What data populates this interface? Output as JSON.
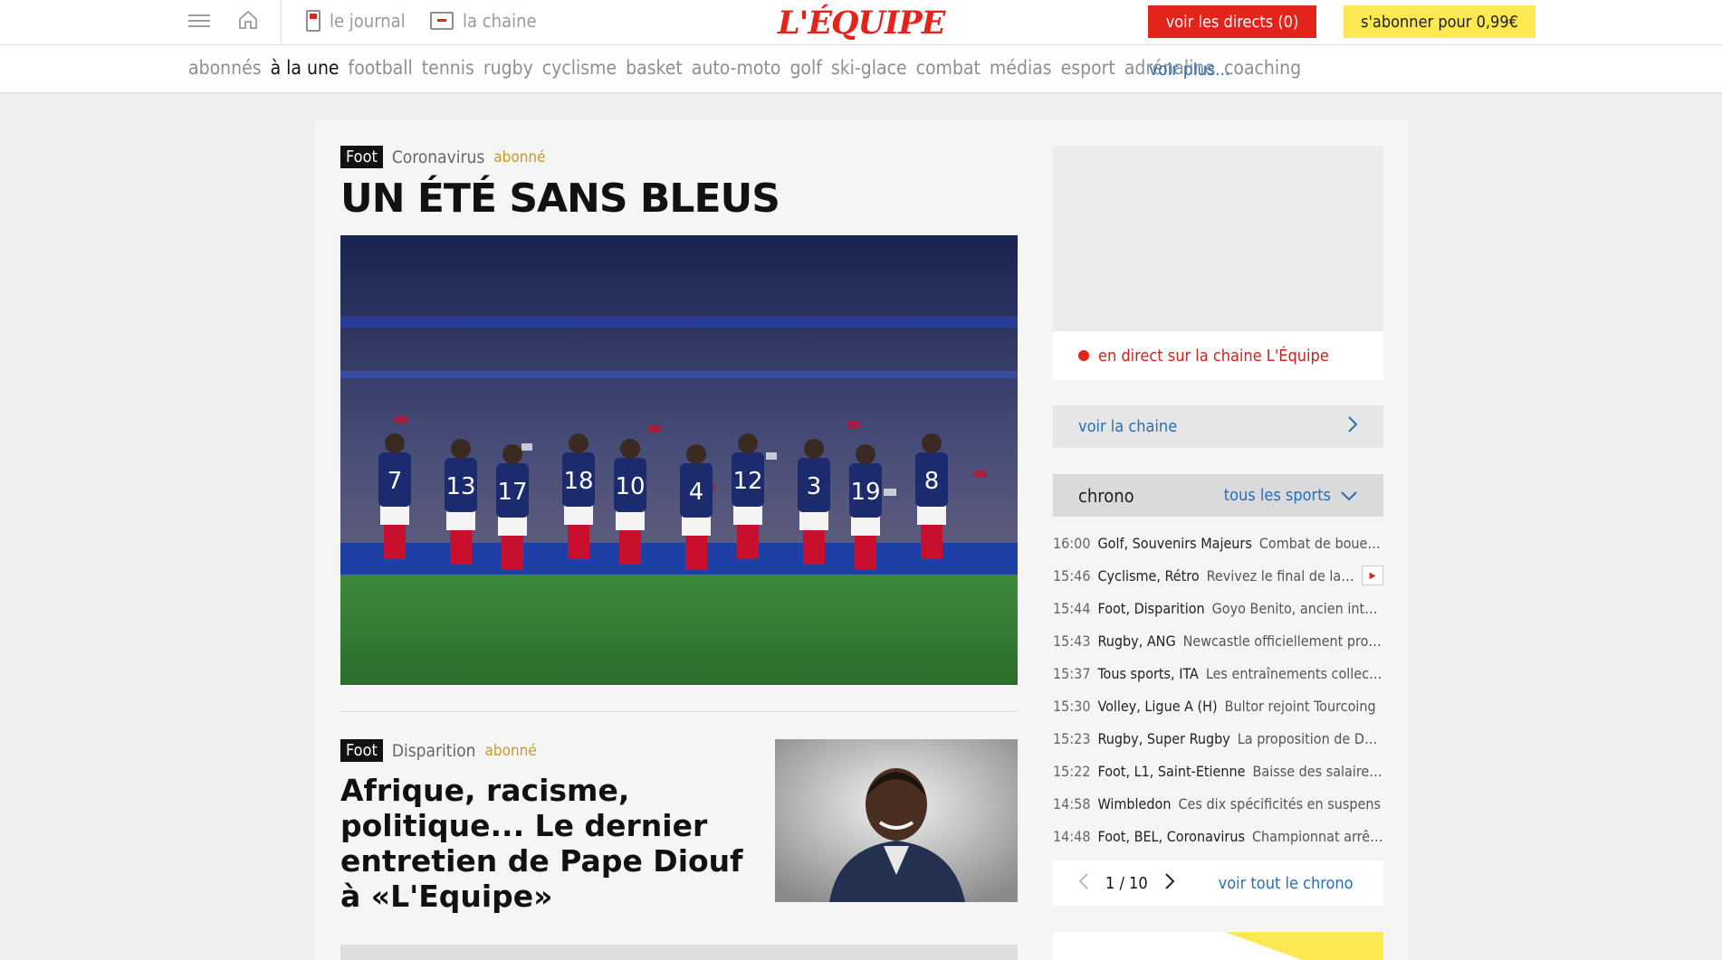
{
  "header": {
    "journal_label": "le journal",
    "chaine_label": "la chaine",
    "logo": "L'ÉQUIPE",
    "directs_label": "voir les directs (0)",
    "abonner_label": "s'abonner pour 0,99€"
  },
  "nav": {
    "items": [
      "abonnés",
      "à la une",
      "football",
      "tennis",
      "rugby",
      "cyclisme",
      "basket",
      "auto-moto",
      "golf",
      "ski-glace",
      "combat",
      "médias",
      "esport",
      "adrénaline",
      "coaching"
    ],
    "active": "à la une",
    "more": "voir plus..."
  },
  "lead": {
    "tag": "Foot",
    "subject": "Coronavirus",
    "premium": "abonné",
    "title": "UN ÉTÉ SANS BLEUS",
    "jersey_numbers": [
      "7",
      "13",
      "17",
      "18",
      "10",
      "4",
      "12",
      "3",
      "19",
      "8"
    ]
  },
  "second": {
    "tag": "Foot",
    "subject": "Disparition",
    "premium": "abonné",
    "title": "Afrique, racisme, politique... Le dernier entretien de Pape Diouf à «L'Equipe»"
  },
  "sidebar": {
    "live_text": "en direct sur la chaine L'Équipe",
    "voir_chaine": "voir la chaine",
    "chrono_title": "chrono",
    "chrono_filter": "tous les sports",
    "chrono": [
      {
        "time": "16:00",
        "cat": "Golf, Souvenirs Majeurs",
        "text": "Combat de boue à Ce...",
        "video": false
      },
      {
        "time": "15:46",
        "cat": "Cyclisme, Rétro",
        "text": "Revivez le final de la de...",
        "video": true
      },
      {
        "time": "15:44",
        "cat": "Foot, Disparition",
        "text": "Goyo Benito, ancien interna...",
        "video": false
      },
      {
        "time": "15:43",
        "cat": "Rugby, ANG",
        "text": "Newcastle officiellement promu",
        "video": false
      },
      {
        "time": "15:37",
        "cat": "Tous sports, ITA",
        "text": "Les entraînements collectif...",
        "video": false
      },
      {
        "time": "15:30",
        "cat": "Volley, Ligue A (H)",
        "text": "Bultor rejoint Tourcoing",
        "video": false
      },
      {
        "time": "15:23",
        "cat": "Rugby, Super Rugby",
        "text": "La proposition de Dobso...",
        "video": false
      },
      {
        "time": "15:22",
        "cat": "Foot, L1, Saint-Etienne",
        "text": "Baisse des salaires e...",
        "video": false
      },
      {
        "time": "14:58",
        "cat": "Wimbledon",
        "text": "Ces dix spécificités en suspens",
        "video": false
      },
      {
        "time": "14:48",
        "cat": "Foot, BEL, Coronavirus",
        "text": "Championnat arrêté, B...",
        "video": false
      }
    ],
    "pagination": "1 / 10",
    "voir_tout": "voir tout le chrono"
  }
}
